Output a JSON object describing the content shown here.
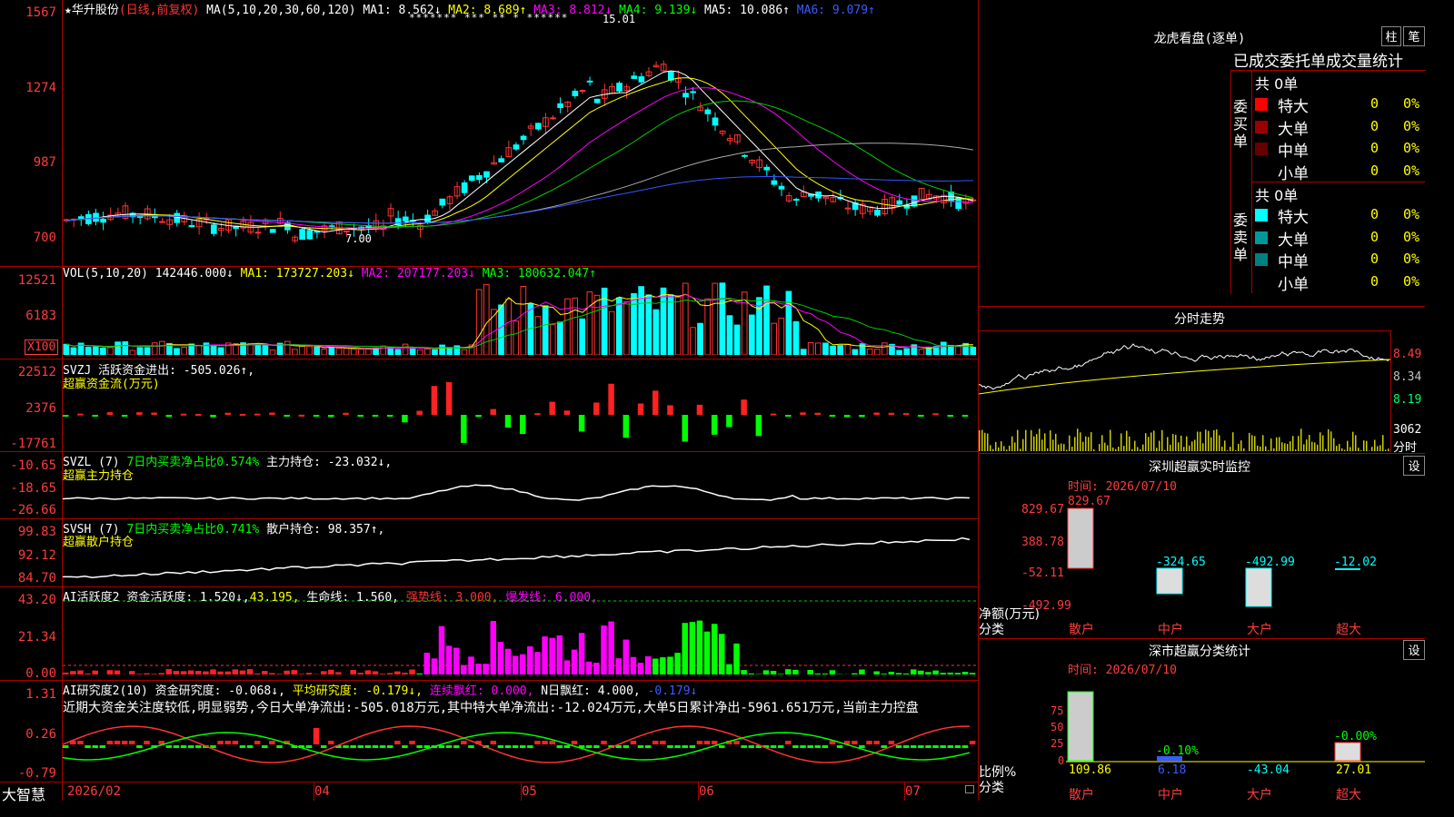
{
  "main": {
    "header": {
      "prefix": "★",
      "name": "华升股份",
      "mode": "(日线,前复权)",
      "ma_group": "MA(5,10,20,30,60,120)",
      "ma1": "MA1: 8.562↓",
      "ma2": "MA2: 8.689↑",
      "ma3": "MA3: 8.812↓",
      "ma4": "MA4: 9.139↓",
      "ma5": "MA5: 10.086↑",
      "ma6": "MA6: 9.079↑"
    },
    "y_ticks": [
      "1567",
      "1274",
      "987",
      "700"
    ],
    "annot_high": "15.01",
    "annot_low": "7.00",
    "star_marks": "******* *** ** * ******"
  },
  "vol": {
    "header": "VOL(5,10,20)",
    "value": "142446.000↓",
    "ma1": "MA1: 173727.203↓",
    "ma2": "MA2: 207177.203↓",
    "ma3": "MA3: 180632.047↑",
    "y_ticks": [
      "12521",
      "6183"
    ],
    "unit": "X100"
  },
  "svzj": {
    "header": "SVZJ  活跃资金进出: -505.026↑,",
    "sub": "超赢资金流(万元)",
    "y_ticks": [
      "22512",
      "2376",
      "-17761"
    ]
  },
  "svzl": {
    "header": "SVZL (7)",
    "pct": "7日内买卖净占比0.574%",
    "main": "主力持仓: -23.032↓,",
    "sub": "超赢主力持仓",
    "y_ticks": [
      "-10.65",
      "-18.65",
      "-26.66"
    ]
  },
  "svsh": {
    "header": "SVSH (7)",
    "pct": "7日内买卖净占比0.741%",
    "main": "散户持仓: 98.357↑,",
    "sub": "超赢散户持仓",
    "y_ticks": [
      "99.83",
      "92.12",
      "84.70"
    ]
  },
  "ai1": {
    "header": "AI活跃度2",
    "a": "资金活跃度: 1.520↓,",
    "b": "43.195,",
    "c": "生命线: 1.560,",
    "d": "强势线: 3.000,",
    "e": "爆发线: 6.000,",
    "y_ticks": [
      "43.20",
      "21.34",
      "0.00"
    ]
  },
  "ai2": {
    "header": "AI研究度2(10)",
    "a": "资金研究度: -0.068↓,",
    "b": "平均研究度: -0.179↓,",
    "c": "连续飘红: 0.000,",
    "d": "N日飘红: 4.000,",
    "e": "-0.179↓",
    "text": "近期大资金关注度较低,明显弱势,今日大单净流出:-505.018万元,其中特大单净流出:-12.024万元,大单5日累计净出-5961.651万元,当前主力控盘",
    "y_ticks": [
      "1.31",
      "0.26",
      "-0.79"
    ]
  },
  "xaxis": {
    "labels": [
      "2026/02",
      "04",
      "05",
      "06",
      "07"
    ]
  },
  "brand": "大智慧",
  "right": {
    "lhb_title": "龙虎看盘(逐单)",
    "btn_bar": "柱",
    "btn_pen": "笔",
    "stat_title": "已成交委托单成交量统计",
    "buy_label": "委买单",
    "sell_label": "委卖单",
    "buy_total": "共 0单",
    "sell_total": "共 0单",
    "buy_rows": [
      {
        "name": "特大",
        "val": "0",
        "pct": "0%",
        "color": "#ff0000"
      },
      {
        "name": "大单",
        "val": "0",
        "pct": "0%",
        "color": "#990000"
      },
      {
        "name": "中单",
        "val": "0",
        "pct": "0%",
        "color": "#660000"
      },
      {
        "name": "小单",
        "val": "0",
        "pct": "0%",
        "color": "#000000"
      }
    ],
    "sell_rows": [
      {
        "name": "特大",
        "val": "0",
        "pct": "0%",
        "color": "#00ffff"
      },
      {
        "name": "大单",
        "val": "0",
        "pct": "0%",
        "color": "#009999"
      },
      {
        "name": "中单",
        "val": "0",
        "pct": "0%",
        "color": "#008080"
      },
      {
        "name": "小单",
        "val": "0",
        "pct": "0%",
        "color": "#000000"
      }
    ],
    "fenshi_title": "分时走势",
    "fenshi_ticks": [
      "8.49",
      "8.34",
      "8.19"
    ],
    "fenshi_vol": "3062",
    "fenshi_unit": "分时",
    "monitor_title": "深圳超赢实时监控",
    "monitor_btn": "设",
    "monitor_time": "时间: 2026/07/10",
    "monitor_ticks": [
      "829.67",
      "388.78",
      "-52.11",
      "-492.99"
    ],
    "monitor_top": "829.67",
    "monitor_vals": [
      "-324.65",
      "-492.99",
      "-12.02"
    ],
    "monitor_ylabel": "净额(万元)",
    "monitor_xlabel": "分类",
    "categories": [
      "散户",
      "中户",
      "大户",
      "超大"
    ],
    "class_title": "深市超赢分类统计",
    "class_btn": "设",
    "class_time": "时间: 2026/07/10",
    "class_ticks": [
      "75",
      "50",
      "25",
      "0"
    ],
    "class_bar_labels": [
      "-0.10%",
      "-0.00%"
    ],
    "class_vals": [
      "109.86",
      "6.18",
      "-43.04",
      "27.01"
    ],
    "class_ylabel": "比例%",
    "class_xlabel": "分类"
  }
}
